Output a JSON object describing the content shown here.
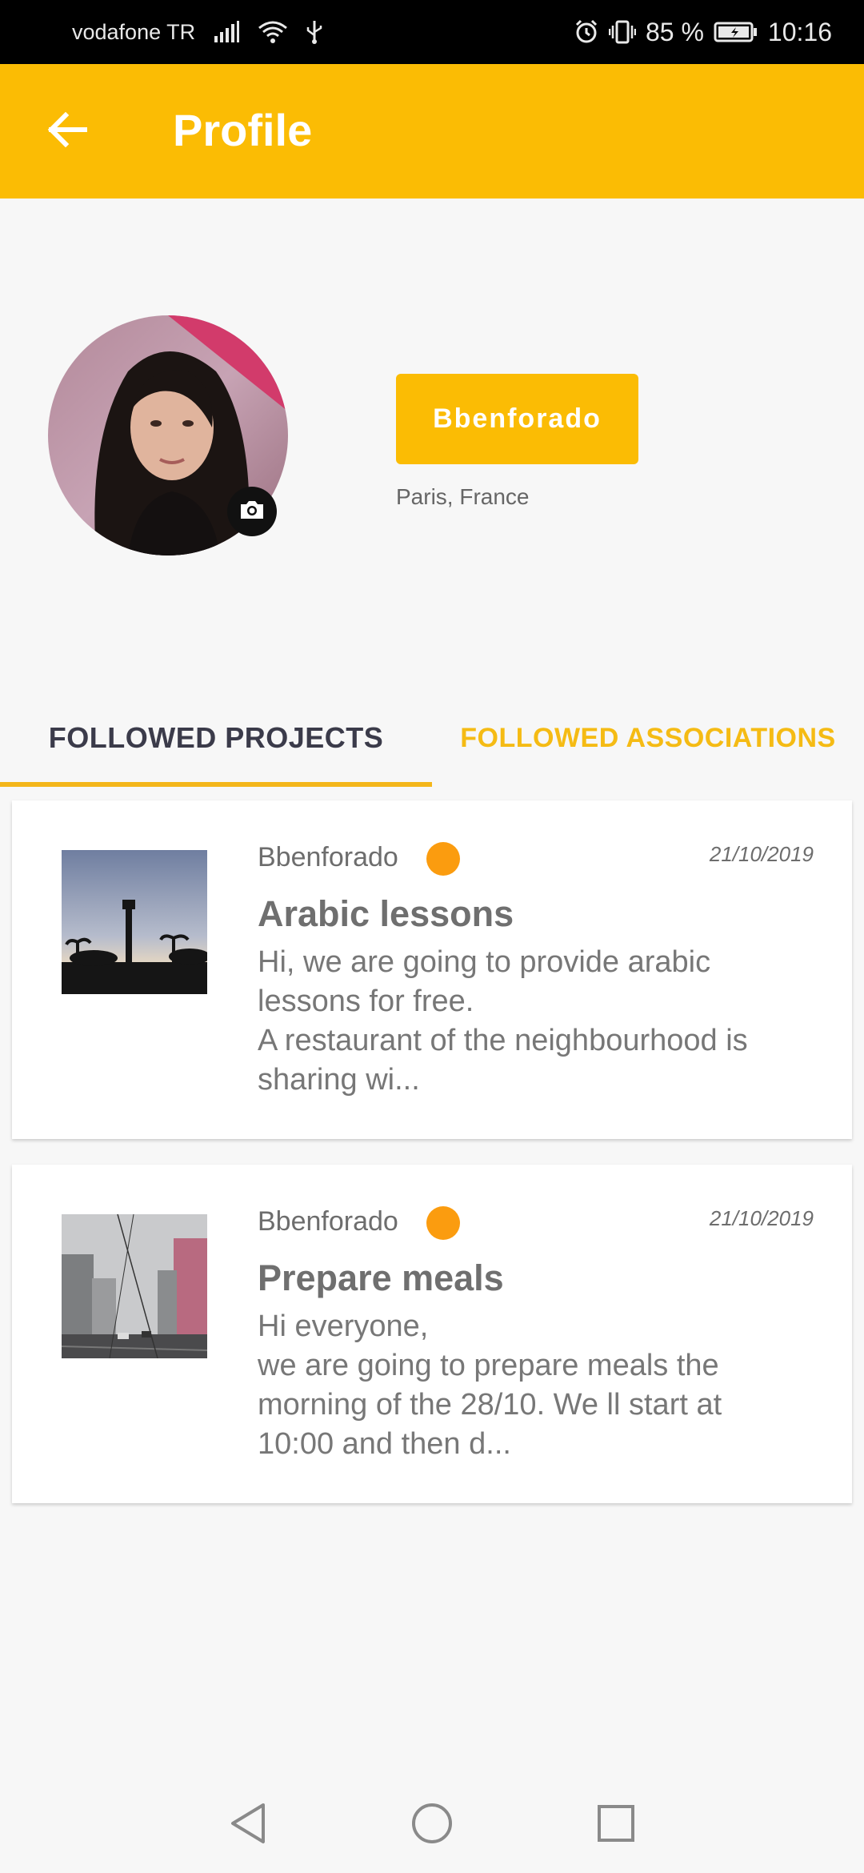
{
  "status_bar": {
    "carrier": "vodafone TR",
    "battery": "85 %",
    "time": "10:16",
    "icons": [
      "signal-icon",
      "wifi-icon",
      "usb-icon",
      "alarm-icon",
      "vibrate-icon",
      "battery-icon"
    ]
  },
  "app_bar": {
    "title": "Profile",
    "back_icon": "arrow-left-icon"
  },
  "profile": {
    "username": "Bbenforado",
    "location": "Paris, France",
    "camera_icon": "camera-icon"
  },
  "tabs": [
    {
      "label": "FOLLOWED PROJECTS",
      "selected": true
    },
    {
      "label": "FOLLOWED ASSOCIATIONS",
      "selected": false
    }
  ],
  "colors": {
    "accent": "#fbbc04",
    "status_dot": "#fb9c0f"
  },
  "projects": [
    {
      "author": "Bbenforado",
      "date": "21/10/2019",
      "title": "Arabic lessons",
      "description": "Hi, we are going to provide arabic\nlessons for free.\nA restaurant of the neighbourhood is\nsharing wi..."
    },
    {
      "author": "Bbenforado",
      "date": "21/10/2019",
      "title": "Prepare meals",
      "description": "Hi everyone,\nwe are going to prepare meals the\nmorning of the 28/10. We ll start at\n10:00 and then d..."
    }
  ],
  "nav": [
    "back-triangle-icon",
    "home-circle-icon",
    "recents-square-icon"
  ]
}
